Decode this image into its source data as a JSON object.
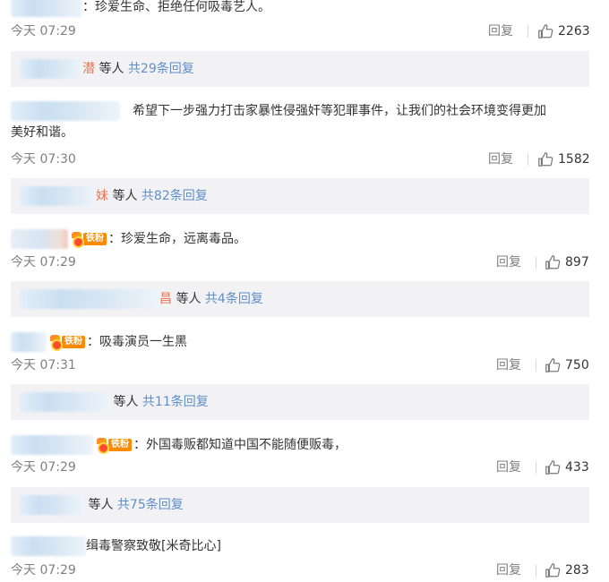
{
  "comments": [
    {
      "text": "：珍爱生命、拒绝任何吸毒艺人。",
      "time": "今天 07:29",
      "reply_label": "回复",
      "likes": "2263",
      "sub": {
        "tail": "潜",
        "suffix": "等人",
        "total": "共29条回复"
      }
    },
    {
      "text": "希望下一步强力打击家暴性侵强奸等犯罪事件，让我们的社会环境变得更加",
      "text2": "美好和谐。",
      "time": "今天 07:30",
      "reply_label": "回复",
      "likes": "1582",
      "sub": {
        "tail": "妹",
        "suffix": "等人",
        "total": "共82条回复"
      }
    },
    {
      "badge": "铁粉",
      "text": "：珍爱生命，远离毒品。",
      "time": "今天 07:29",
      "reply_label": "回复",
      "likes": "897",
      "sub": {
        "tail": "昌",
        "suffix": "等人",
        "total": "共4条回复"
      }
    },
    {
      "badge": "铁粉",
      "text": "：吸毒演员一生黑",
      "time": "今天 07:31",
      "reply_label": "回复",
      "likes": "750",
      "sub": {
        "tail": "",
        "suffix": "等人",
        "total": "共11条回复"
      }
    },
    {
      "badge": "铁粉",
      "text": "：外国毒贩都知道中国不能随便贩毒，",
      "time": "今天 07:29",
      "reply_label": "回复",
      "likes": "433",
      "sub": {
        "tail": "",
        "suffix": "等人",
        "total": "共75条回复"
      }
    },
    {
      "text": "缉毒警察致敬[米奇比心]",
      "time": "今天 07:29",
      "reply_label": "回复",
      "likes": "283"
    }
  ],
  "colors": {
    "link": "#eb7350",
    "total": "#5f8fc9",
    "meta": "#808080",
    "sub_bg": "#f2f2f5"
  },
  "icons": {
    "like": "thumbs-up-icon",
    "badge": "iron-fan-medal-icon"
  }
}
